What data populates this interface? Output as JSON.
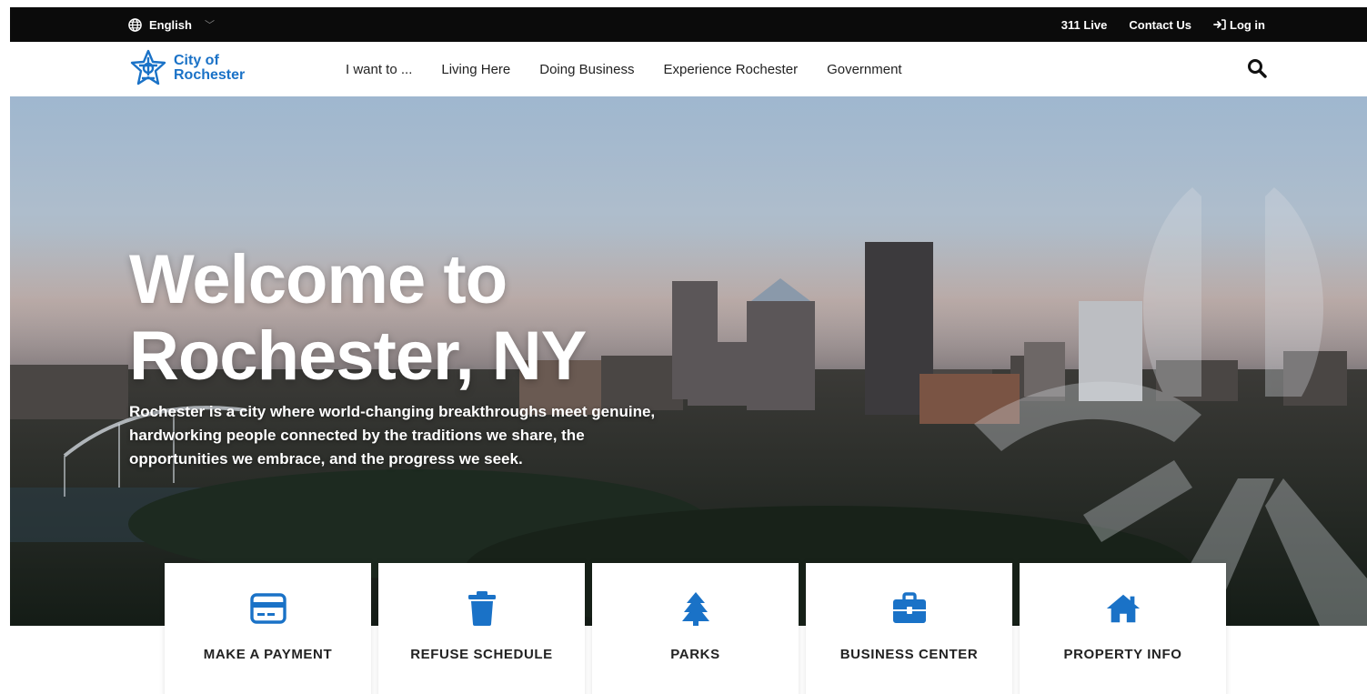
{
  "utility_bar": {
    "language": "English",
    "links": [
      "311 Live",
      "Contact Us",
      "Log in"
    ]
  },
  "header": {
    "logo_line1": "City of",
    "logo_line2": "Rochester",
    "nav": [
      "I want to ...",
      "Living Here",
      "Doing Business",
      "Experience Rochester",
      "Government"
    ]
  },
  "hero": {
    "title_line1": "Welcome to",
    "title_line2": "Rochester, NY",
    "subtitle": "Rochester is a city where world-changing breakthroughs meet genuine, hardworking people connected by the traditions we share, the opportunities we embrace, and the progress we seek."
  },
  "quick_links": [
    {
      "label": "MAKE A PAYMENT",
      "icon": "credit-card-icon"
    },
    {
      "label": "REFUSE SCHEDULE",
      "icon": "trash-icon"
    },
    {
      "label": "PARKS",
      "icon": "tree-icon"
    },
    {
      "label": "BUSINESS CENTER",
      "icon": "briefcase-icon"
    },
    {
      "label": "PROPERTY INFO",
      "icon": "house-icon"
    }
  ],
  "colors": {
    "accent": "#1a72c7",
    "utility_bar": "#0b0b0b"
  }
}
